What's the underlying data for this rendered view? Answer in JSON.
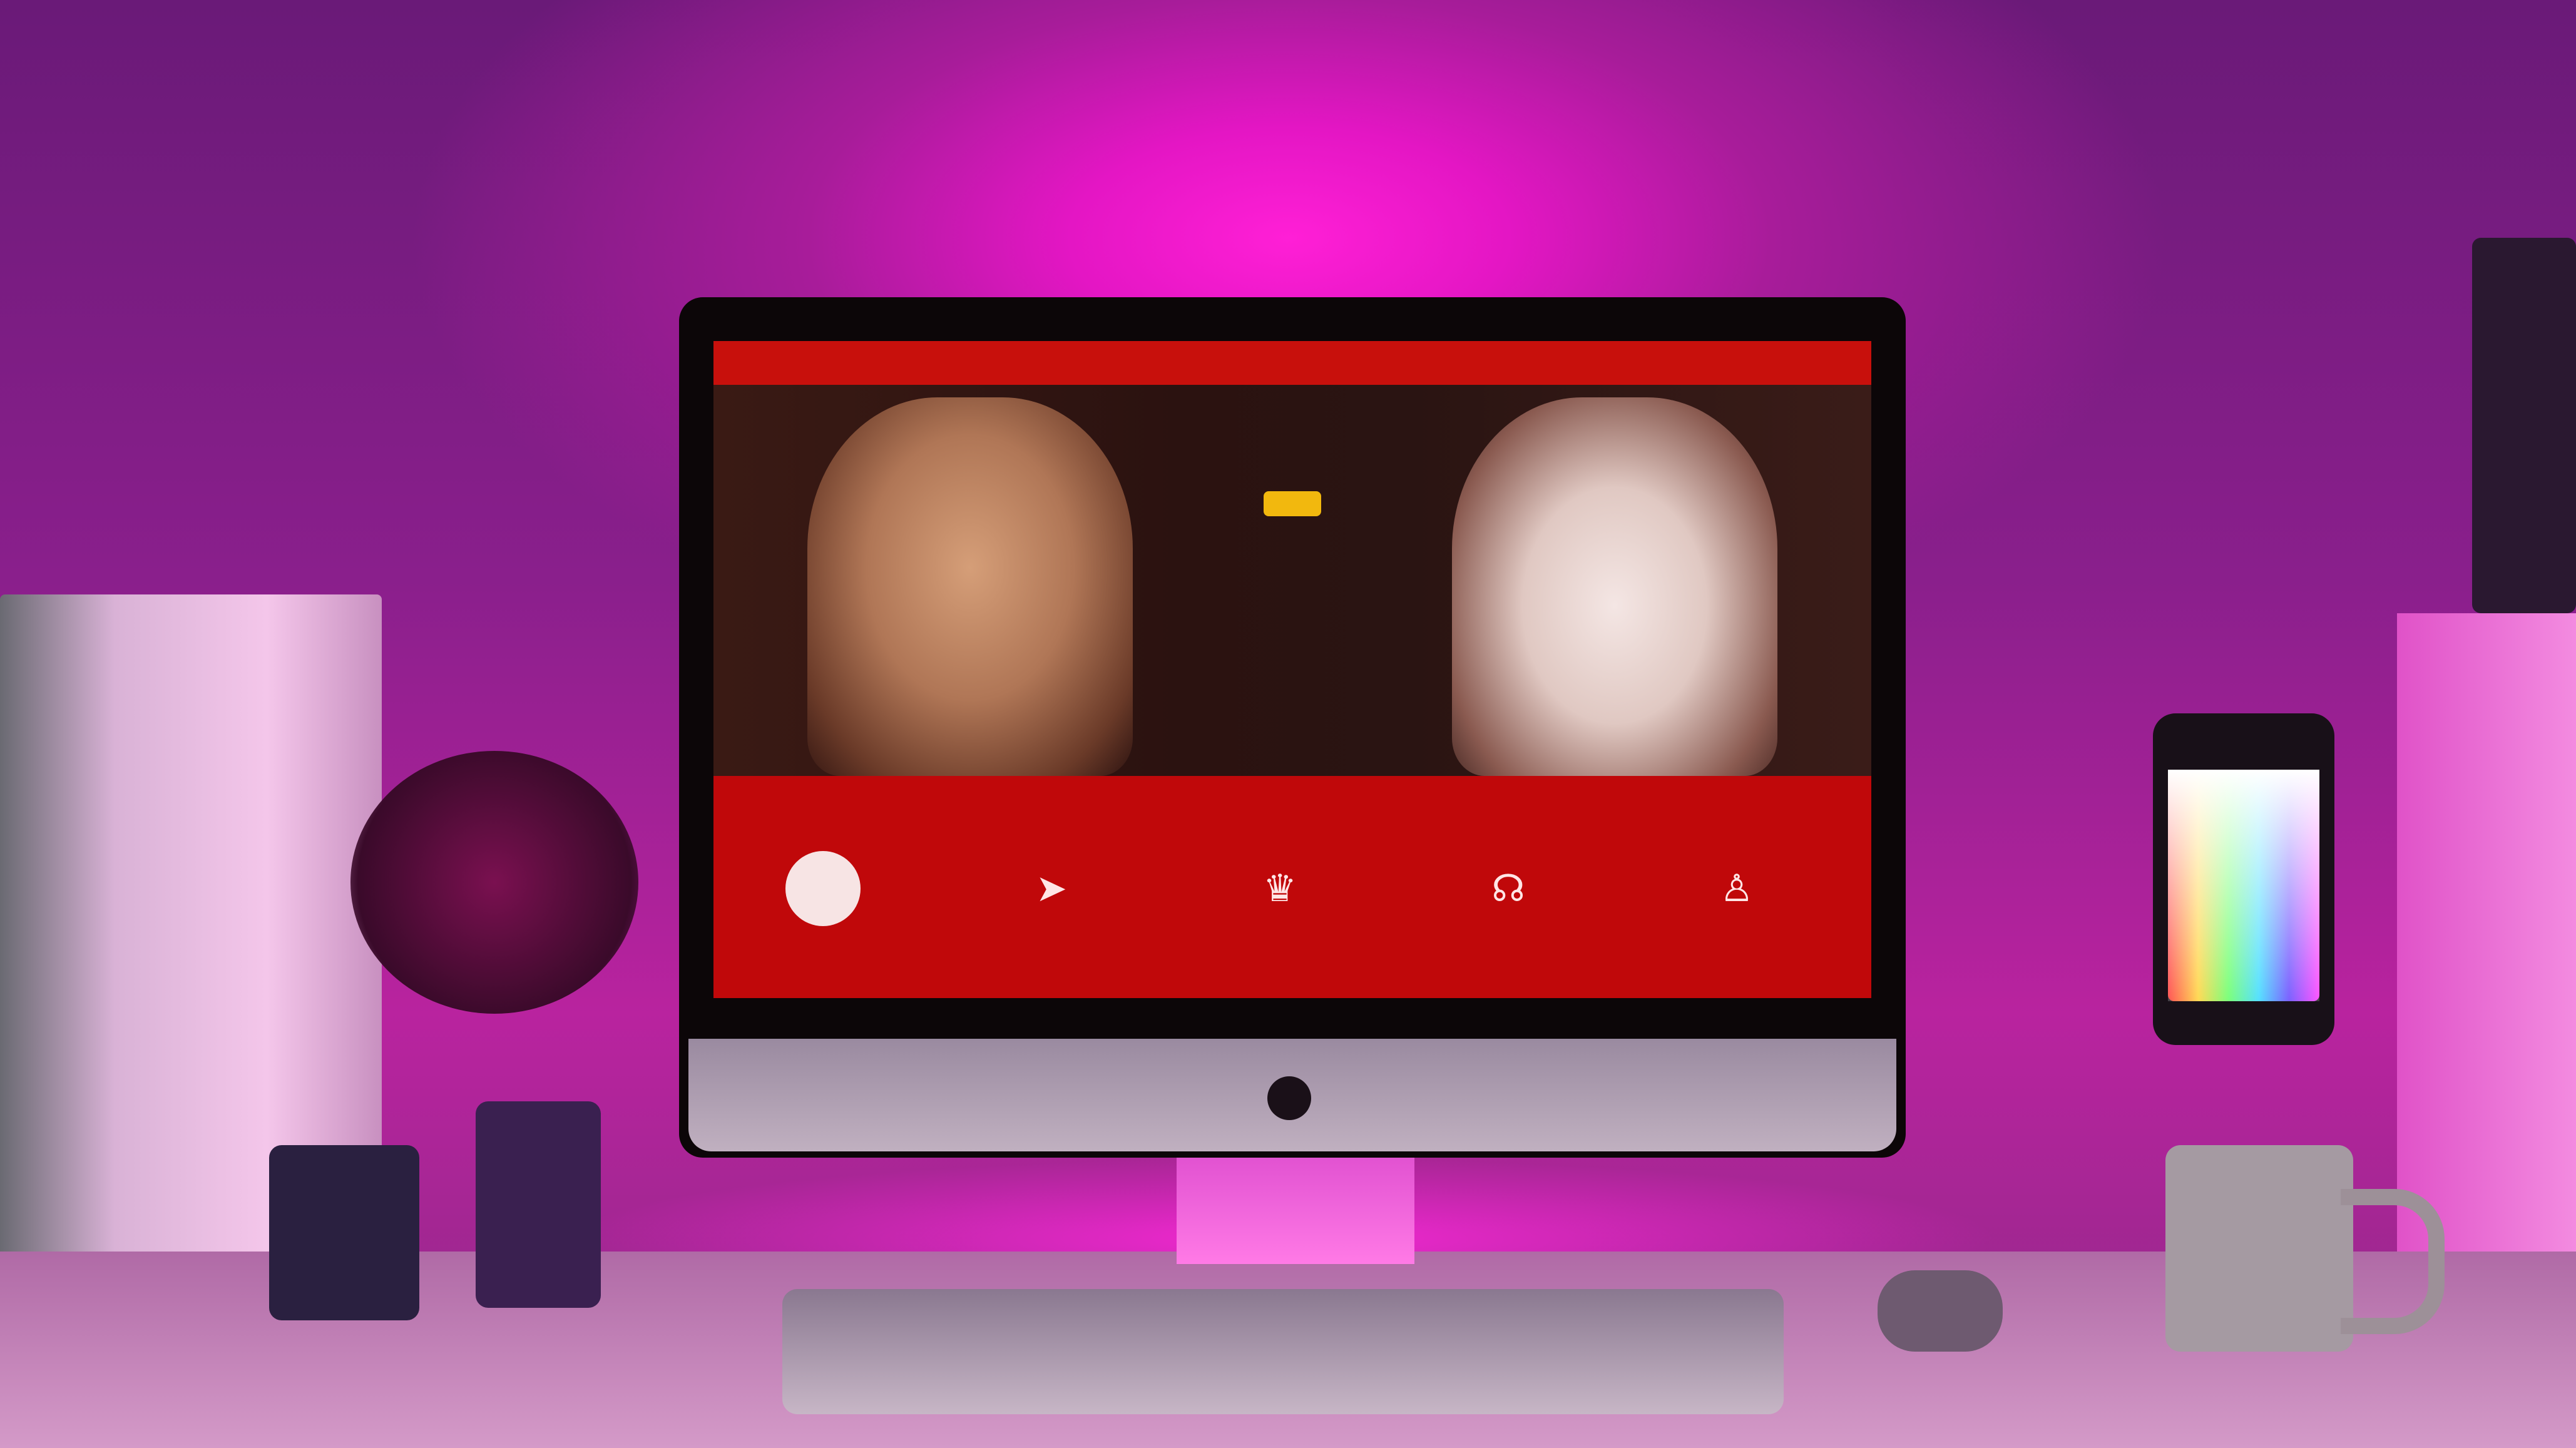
{
  "scene": {
    "description_tag": "",
    "monitor": {
      "hero": {
        "headline": "",
        "subheadline": "",
        "promo": "",
        "subtext": "",
        "button_label": ""
      },
      "features": {
        "title": "",
        "items": [
          {
            "icon": "circle-icon",
            "label": ""
          },
          {
            "icon": "send-icon",
            "label": ""
          },
          {
            "icon": "crown-icon",
            "label": ""
          },
          {
            "icon": "headset-icon",
            "label": ""
          },
          {
            "icon": "person-icon",
            "label": ""
          }
        ]
      }
    }
  },
  "colors": {
    "wall_glow": "#ff1fd6",
    "site_red": "#c0080a",
    "promo_yellow": "#f2c21e"
  }
}
